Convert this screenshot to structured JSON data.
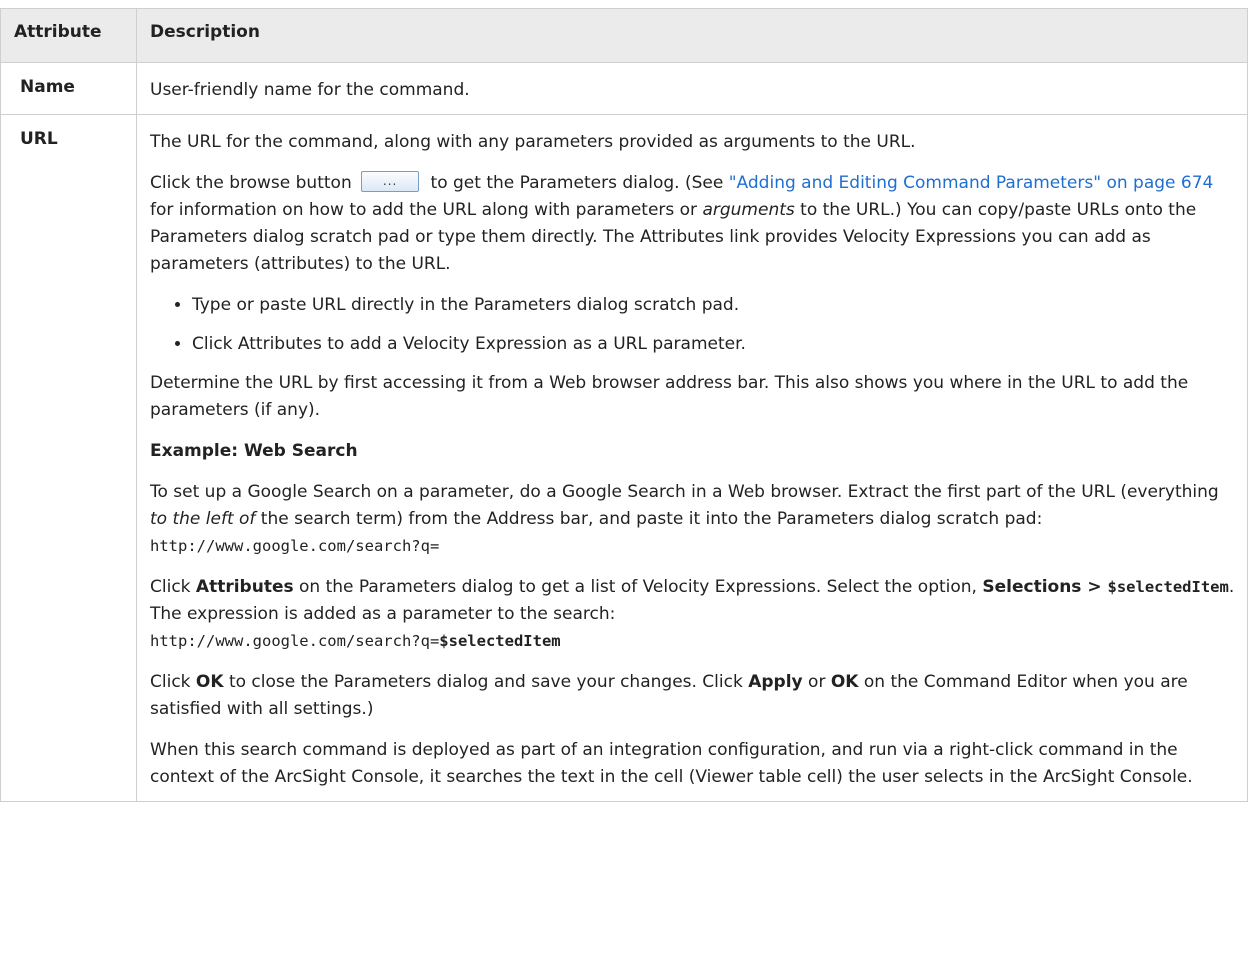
{
  "table": {
    "headers": {
      "attribute": "Attribute",
      "description": "Description"
    },
    "row_name": {
      "attribute": "Name",
      "description": "User-friendly name for the command."
    },
    "row_url": {
      "attribute": "URL",
      "p1": "The URL for the command, along with any parameters provided as arguments to the URL.",
      "p2_a": "Click the browse button ",
      "browse_button_label": "...",
      "p2_b": " to get the Parameters dialog. (See ",
      "p2_link": "\"Adding and Editing Command Parameters\" on page 674",
      "p2_c": " for information on how to add the URL along with parameters or ",
      "p2_em": "arguments",
      "p2_d": " to the URL.) You can copy/paste URLs onto the Parameters dialog scratch pad or type them directly. The Attributes link provides Velocity Expressions you can add as parameters (attributes) to the URL.",
      "bullets": [
        "Type or paste URL directly in the Parameters dialog scratch pad.",
        "Click Attributes to add a Velocity Expression as a URL parameter."
      ],
      "p3": "Determine the URL by first accessing it from a Web browser address bar. This also shows you where in the URL to add the parameters (if any).",
      "example_heading": "Example: Web Search",
      "p4_a": "To set up a Google Search on a parameter, do a Google Search in a Web browser. Extract the first part of the URL (everything ",
      "p4_em": "to the left of",
      "p4_b": " the search term) from the Address bar, and paste it into the Parameters dialog scratch pad: ",
      "p4_code": "http://www.google.com/search?q=",
      "p5_a": "Click ",
      "p5_b1": "Attributes",
      "p5_c": " on the Parameters dialog to get a list of Velocity Expressions. Select the option, ",
      "p5_b2": "Selections > ",
      "p5_code_bold": "$selectedItem",
      "p5_d": ". The expression is added as a parameter to the search: ",
      "p5_code": "http://www.google.com/search?q=",
      "p5_code_bold2": "$selectedItem",
      "p6_a": "Click ",
      "p6_b1": "OK",
      "p6_c": " to close the Parameters dialog and save your changes. Click ",
      "p6_b2": "Apply",
      "p6_d": " or ",
      "p6_b3": "OK",
      "p6_e": " on the Command Editor when you are satisfied with all settings.)",
      "p7": "When this search command is deployed as part of an integration configuration, and run via a right-click command in the context of the ArcSight Console, it searches the text in the cell (Viewer table cell) the user selects in the ArcSight Console."
    }
  }
}
